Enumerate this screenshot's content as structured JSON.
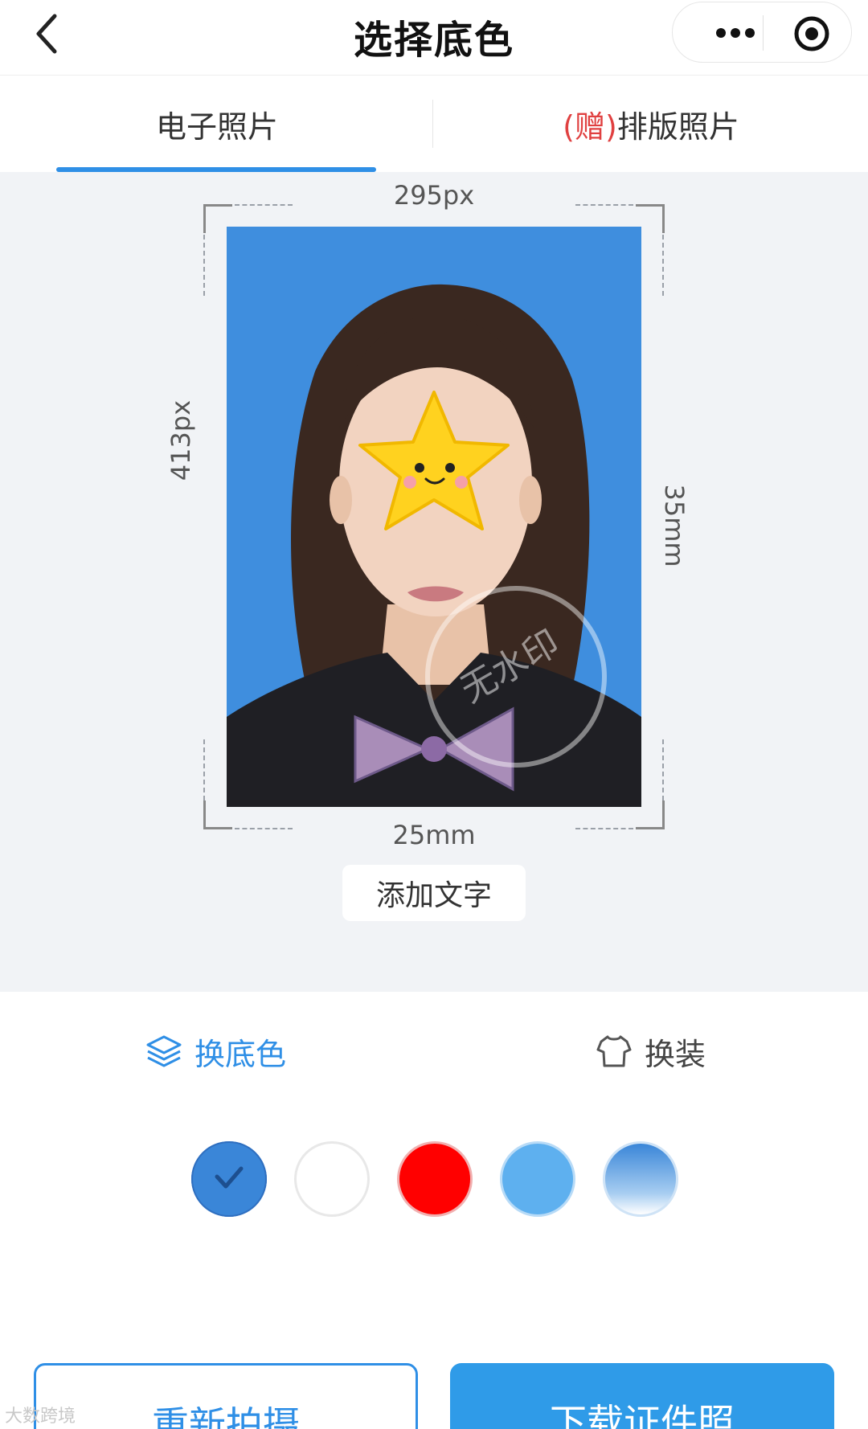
{
  "header": {
    "title": "选择底色",
    "icons": {
      "back": "chevron-left-icon",
      "more": "more-dots-icon",
      "target": "record-target-icon"
    }
  },
  "tabs": {
    "electronic": "电子照片",
    "gift_prefix": "(赠)",
    "layout": "排版照片"
  },
  "preview": {
    "width_px": "295px",
    "height_px": "413px",
    "width_mm": "25mm",
    "height_mm": "35mm",
    "watermark_text": "无水印",
    "add_text_button": "添加文字",
    "photo_background": "#3f8ede"
  },
  "tools": {
    "change_bg": "换底色",
    "change_outfit": "换装"
  },
  "swatches": [
    {
      "color": "#3a86d8",
      "selected": true
    },
    {
      "color": "#ffffff",
      "selected": false
    },
    {
      "color": "#ff0000",
      "selected": false
    },
    {
      "color": "#5eb0ef",
      "selected": false
    },
    {
      "color": "gradient-blue",
      "selected": false
    }
  ],
  "buttons": {
    "retake": "重新拍摄",
    "download": "下载证件照"
  },
  "corner_logo": "大数跨境"
}
